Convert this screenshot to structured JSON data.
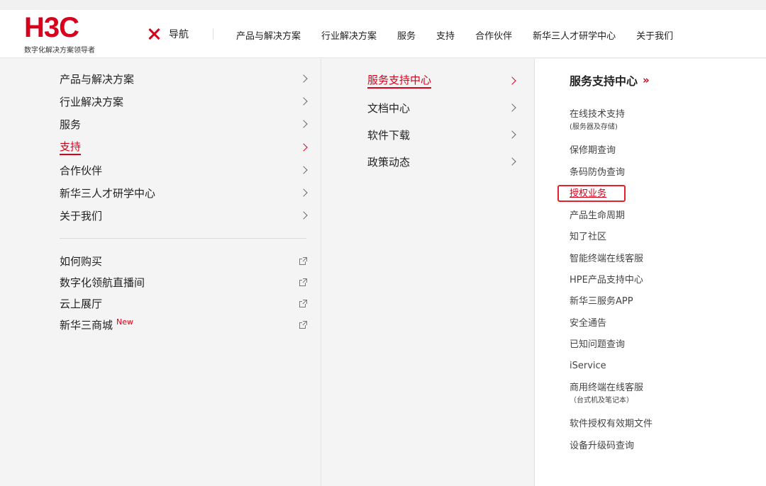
{
  "header": {
    "logo_text": "H3C",
    "logo_tagline": "数字化解决方案领导者",
    "nav_toggle_label": "导航",
    "top_nav": [
      "产品与解决方案",
      "行业解决方案",
      "服务",
      "支持",
      "合作伙伴",
      "新华三人才研学中心",
      "关于我们"
    ]
  },
  "left_menu": {
    "items": [
      "产品与解决方案",
      "行业解决方案",
      "服务",
      "支持",
      "合作伙伴",
      "新华三人才研学中心",
      "关于我们"
    ],
    "active": "支持",
    "external_links": [
      {
        "label": "如何购买",
        "badge": ""
      },
      {
        "label": "数字化领航直播间",
        "badge": ""
      },
      {
        "label": "云上展厅",
        "badge": ""
      },
      {
        "label": "新华三商城",
        "badge": "New"
      }
    ]
  },
  "sub_menu": {
    "items": [
      "服务支持中心",
      "文档中心",
      "软件下载",
      "政策动态"
    ],
    "active": "服务支持中心"
  },
  "detail_panel": {
    "title": "服务支持中心",
    "title_chevron": "»",
    "links": [
      {
        "label": "在线技术支持",
        "note": "(服务器及存储)"
      },
      {
        "label": "保修期查询",
        "note": ""
      },
      {
        "label": "条码防伪查询",
        "note": ""
      },
      {
        "label": "授权业务",
        "note": "",
        "highlighted": true
      },
      {
        "label": "产品生命周期",
        "note": ""
      },
      {
        "label": "知了社区",
        "note": ""
      },
      {
        "label": "智能终端在线客服",
        "note": ""
      },
      {
        "label": "HPE产品支持中心",
        "note": ""
      },
      {
        "label": "新华三服务APP",
        "note": ""
      },
      {
        "label": "安全通告",
        "note": ""
      },
      {
        "label": "已知问题查询",
        "note": ""
      },
      {
        "label": "iService",
        "note": ""
      },
      {
        "label": "商用终端在线客服",
        "note": "（台式机及笔记本）"
      },
      {
        "label": "软件授权有效期文件",
        "note": ""
      },
      {
        "label": "设备升级码查询",
        "note": ""
      }
    ]
  },
  "colors": {
    "brand_red": "#d9001b",
    "highlight_box": "#e5202b"
  }
}
